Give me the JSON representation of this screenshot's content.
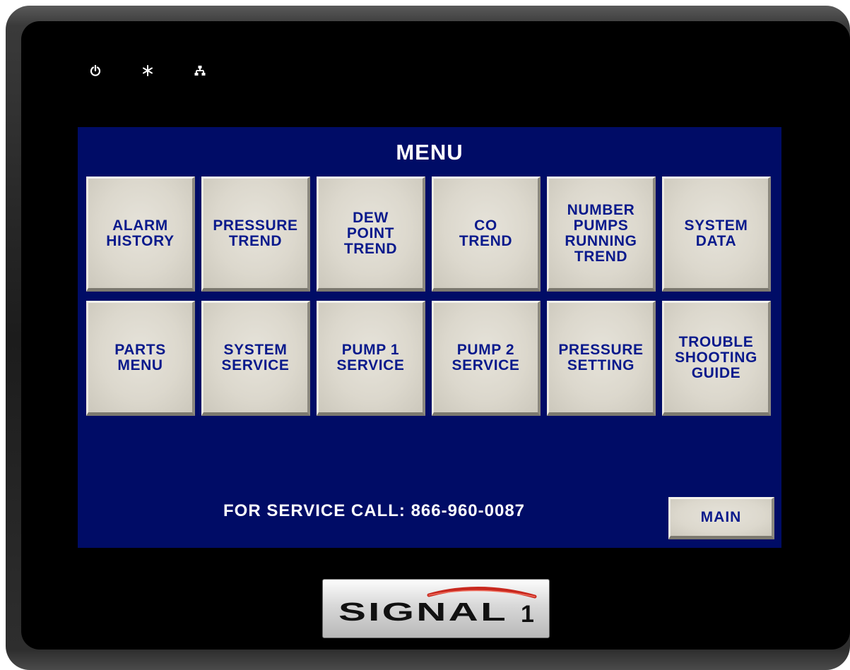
{
  "indicators": [
    {
      "icon": "power-icon"
    },
    {
      "icon": "asterisk-icon"
    },
    {
      "icon": "network-icon"
    }
  ],
  "screen": {
    "title": "MENU",
    "buttons_row1": [
      {
        "id": "alarm-history",
        "lines": [
          "ALARM",
          "HISTORY"
        ]
      },
      {
        "id": "pressure-trend",
        "lines": [
          "PRESSURE",
          "TREND"
        ]
      },
      {
        "id": "dew-point-trend",
        "lines": [
          "DEW",
          "POINT",
          "TREND"
        ]
      },
      {
        "id": "co-trend",
        "lines": [
          "CO",
          "TREND"
        ]
      },
      {
        "id": "number-pumps-running-trend",
        "lines": [
          "NUMBER",
          "PUMPS",
          "RUNNING",
          "TREND"
        ]
      },
      {
        "id": "system-data",
        "lines": [
          "SYSTEM",
          "DATA"
        ]
      }
    ],
    "buttons_row2": [
      {
        "id": "parts-menu",
        "lines": [
          "PARTS",
          "MENU"
        ]
      },
      {
        "id": "system-service",
        "lines": [
          "SYSTEM",
          "SERVICE"
        ]
      },
      {
        "id": "pump-1-service",
        "lines": [
          "PUMP 1",
          "SERVICE"
        ]
      },
      {
        "id": "pump-2-service",
        "lines": [
          "PUMP 2",
          "SERVICE"
        ]
      },
      {
        "id": "pressure-setting",
        "lines": [
          "PRESSURE",
          "SETTING"
        ]
      },
      {
        "id": "trouble-shooting-guide",
        "lines": [
          "TROUBLE",
          "SHOOTING",
          "GUIDE"
        ]
      }
    ],
    "service_text": "FOR SERVICE CALL: 866-960-0087",
    "main_button": "MAIN"
  },
  "logo": {
    "text": "SIGNAL",
    "number": "1"
  },
  "colors": {
    "screen_bg": "#000c66",
    "button_text": "#0a1a8c",
    "button_face": "#dcd8cd",
    "bezel": "#000000"
  }
}
